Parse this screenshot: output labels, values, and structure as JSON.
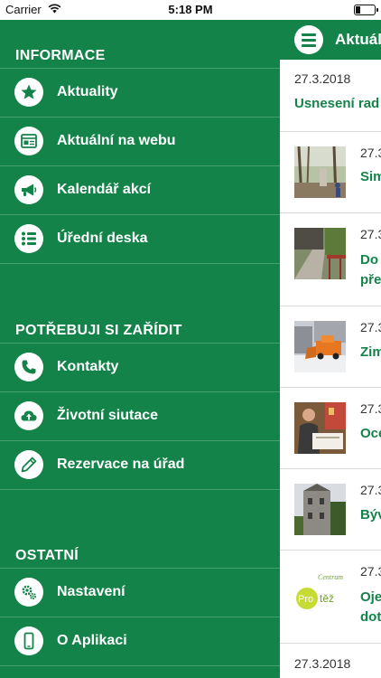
{
  "status_bar": {
    "carrier": "Carrier",
    "time": "5:18 PM"
  },
  "drawer": {
    "sections": [
      {
        "title": "INFORMACE",
        "items": [
          {
            "label": "Aktuality",
            "icon": "star-icon"
          },
          {
            "label": "Aktuální na webu",
            "icon": "web-page-icon"
          },
          {
            "label": "Kalendář akcí",
            "icon": "megaphone-icon"
          },
          {
            "label": "Úřední deska",
            "icon": "list-icon"
          }
        ]
      },
      {
        "title": "POTŘEBUJI SI ZAŘÍDIT",
        "items": [
          {
            "label": "Kontakty",
            "icon": "phone-icon"
          },
          {
            "label": "Životní siutace",
            "icon": "cloud-upload-icon"
          },
          {
            "label": "Rezervace na úřad",
            "icon": "pencil-icon"
          }
        ]
      },
      {
        "title": "OSTATNÍ",
        "items": [
          {
            "label": "Nastavení",
            "icon": "gear-icon"
          },
          {
            "label": "O Aplikaci",
            "icon": "mobile-icon"
          }
        ]
      }
    ]
  },
  "content": {
    "app_bar_title": "Aktuál",
    "news": [
      {
        "date": "27.3.2018",
        "title": "Usnesení rad"
      },
      {
        "date": "27.3",
        "title": "Sim"
      },
      {
        "date": "27.3",
        "title": "Do",
        "title2": "pře"
      },
      {
        "date": "27.3",
        "title": "Zim"
      },
      {
        "date": "27.3",
        "title": "Oce"
      },
      {
        "date": "27.3",
        "title": "Býv"
      },
      {
        "date": "27.3",
        "title": "Oje",
        "title2": "dot"
      },
      {
        "date": "27.3.2018"
      }
    ],
    "logo_text": {
      "top": "Centrum",
      "left": "Pro",
      "right": "těž"
    }
  },
  "colors": {
    "brand_green": "#14834a",
    "divider": "#d9d9d9"
  }
}
